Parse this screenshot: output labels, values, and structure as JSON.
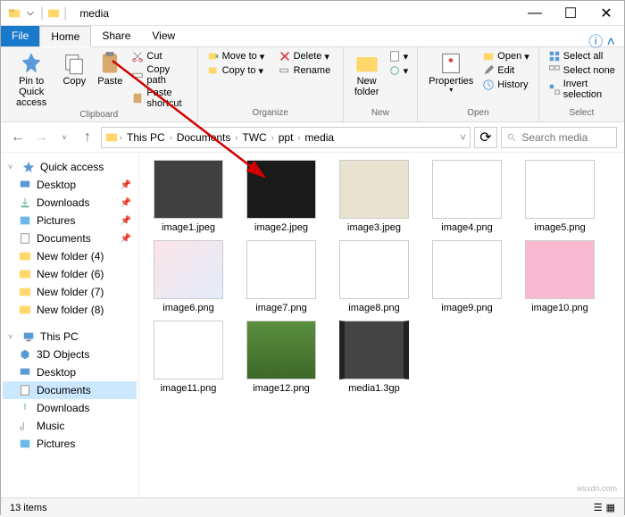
{
  "window": {
    "title": "media"
  },
  "tabs": {
    "file": "File",
    "home": "Home",
    "share": "Share",
    "view": "View"
  },
  "ribbon": {
    "pin": "Pin to Quick\naccess",
    "copy": "Copy",
    "paste": "Paste",
    "cut": "Cut",
    "copy_path": "Copy path",
    "paste_shortcut": "Paste shortcut",
    "move_to": "Move to",
    "copy_to": "Copy to",
    "delete": "Delete",
    "rename": "Rename",
    "new_folder": "New\nfolder",
    "properties": "Properties",
    "open": "Open",
    "edit": "Edit",
    "history": "History",
    "select_all": "Select all",
    "select_none": "Select none",
    "invert_selection": "Invert selection",
    "g_clipboard": "Clipboard",
    "g_organize": "Organize",
    "g_new": "New",
    "g_open": "Open",
    "g_select": "Select"
  },
  "crumbs": {
    "this_pc": "This PC",
    "documents": "Documents",
    "twc": "TWC",
    "ppt": "ppt",
    "media": "media"
  },
  "search": {
    "placeholder": "Search media"
  },
  "sidebar": {
    "quick_access": "Quick access",
    "desktop": "Desktop",
    "downloads": "Downloads",
    "pictures": "Pictures",
    "documents": "Documents",
    "nf4": "New folder (4)",
    "nf6": "New folder (6)",
    "nf7": "New folder (7)",
    "nf8": "New folder (8)",
    "this_pc": "This PC",
    "objects3d": "3D Objects",
    "desktop2": "Desktop",
    "documents2": "Documents",
    "downloads2": "Downloads",
    "music": "Music",
    "pictures2": "Pictures"
  },
  "files": [
    {
      "name": "image1.jpeg",
      "th": "th-dark"
    },
    {
      "name": "image2.jpeg",
      "th": "th-darker"
    },
    {
      "name": "image3.jpeg",
      "th": "th-paper"
    },
    {
      "name": "image4.png",
      "th": "th-white"
    },
    {
      "name": "image5.png",
      "th": "th-white"
    },
    {
      "name": "image6.png",
      "th": "th-diag"
    },
    {
      "name": "image7.png",
      "th": "th-white"
    },
    {
      "name": "image8.png",
      "th": "th-white"
    },
    {
      "name": "image9.png",
      "th": "th-white"
    },
    {
      "name": "image10.png",
      "th": "th-pink"
    },
    {
      "name": "image11.png",
      "th": "th-white"
    },
    {
      "name": "image12.png",
      "th": "th-green"
    },
    {
      "name": "media1.3gp",
      "th": "th-video"
    }
  ],
  "status": {
    "count": "13 items"
  },
  "watermark": "wsxdn.com"
}
